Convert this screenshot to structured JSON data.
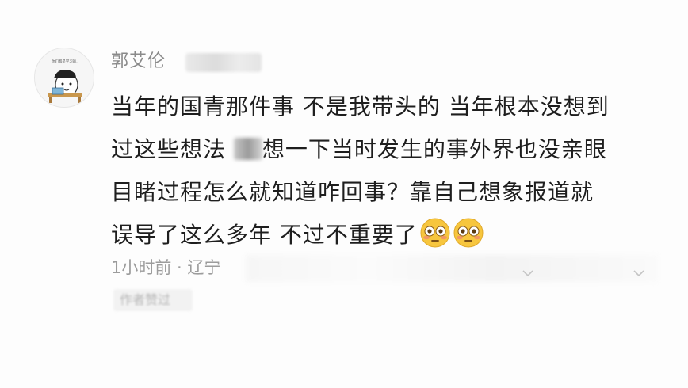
{
  "comment": {
    "username": "郭艾伦",
    "avatar_caption": "你们都是学习的..",
    "text_lines": [
      "当年的国青那件事 不是我带头的 当年根本没想到",
      [
        "过这些想法 ",
        "想一下当时发生的事外界也没亲眼"
      ],
      "目睹过程怎么就知道咋回事？靠自己想象报道就",
      "误导了这么多年  不过不重要了"
    ],
    "emojis": [
      "flushed-face",
      "flushed-face"
    ],
    "meta": "1小时前 · 辽宁",
    "author_liked": "作者赞过"
  },
  "colors": {
    "text": "#1e1e1e",
    "muted": "#9c9c9c",
    "username": "#8a8a8a",
    "emoji_face": "#f7c63e"
  }
}
